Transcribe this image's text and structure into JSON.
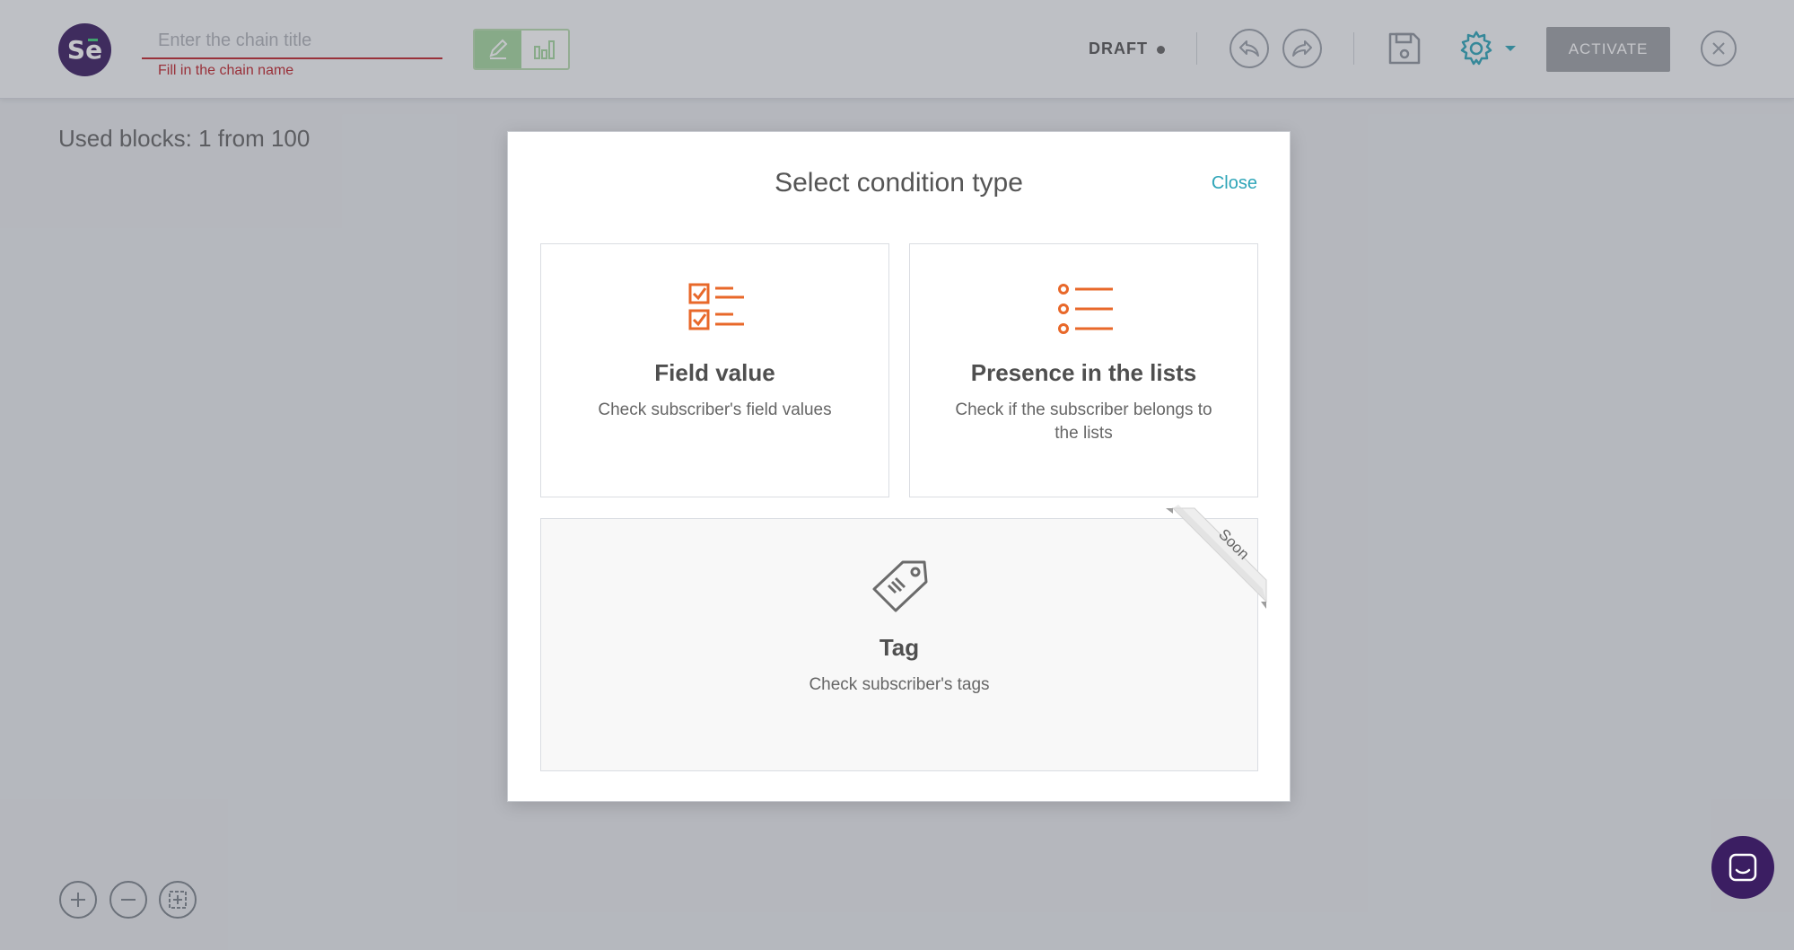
{
  "header": {
    "logo_text": "Se",
    "title_placeholder": "Enter the chain title",
    "title_value": "",
    "title_error": "Fill in the chain name",
    "status": "DRAFT",
    "activate_label": "ACTIVATE"
  },
  "canvas": {
    "used_blocks": "Used blocks: 1 from 100"
  },
  "modal": {
    "title": "Select condition type",
    "close_label": "Close",
    "options": [
      {
        "title": "Field value",
        "description": "Check subscriber's field values",
        "icon": "checklist-icon",
        "enabled": true
      },
      {
        "title": "Presence in the lists",
        "description": "Check if the subscriber belongs to the lists",
        "icon": "list-icon",
        "enabled": true
      },
      {
        "title": "Tag",
        "description": "Check subscriber's tags",
        "icon": "tag-icon",
        "enabled": false,
        "badge": "Soon"
      }
    ]
  },
  "colors": {
    "brand": "#3b1e62",
    "accent": "#2ea5b8",
    "icon_orange": "#e8682a",
    "error": "#c0262d"
  }
}
